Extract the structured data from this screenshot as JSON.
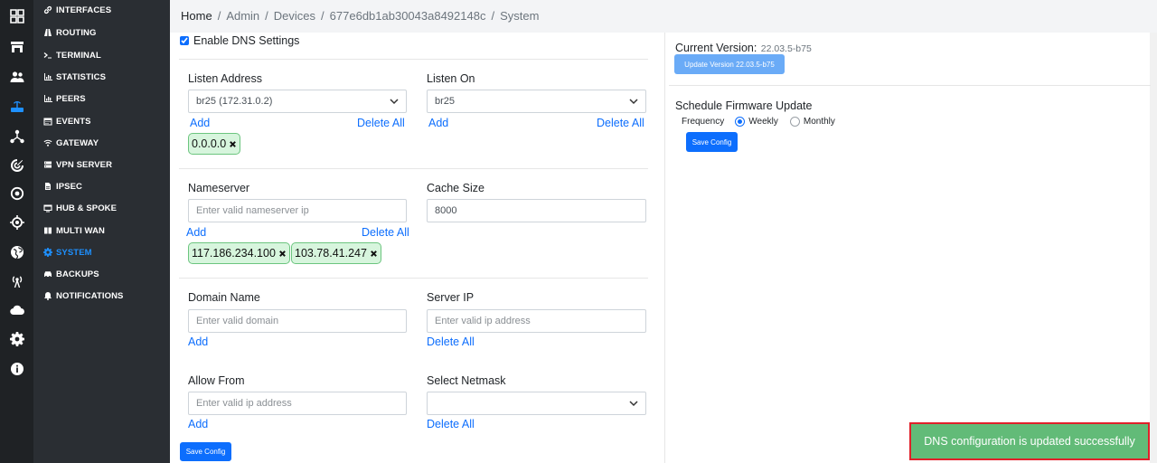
{
  "rail": [
    {
      "icon": "grid-icon"
    },
    {
      "icon": "store-icon"
    },
    {
      "icon": "users-icon"
    },
    {
      "icon": "router-icon",
      "active": true
    },
    {
      "icon": "network-icon"
    },
    {
      "icon": "radar-icon"
    },
    {
      "icon": "target-icon"
    },
    {
      "icon": "crosshair-icon"
    },
    {
      "icon": "globe-icon"
    },
    {
      "icon": "antenna-icon"
    },
    {
      "icon": "cloud-icon"
    },
    {
      "icon": "gear-icon"
    },
    {
      "icon": "info-icon"
    }
  ],
  "sidebar": {
    "items": [
      {
        "label": "INTERFACES",
        "icon": "link-icon"
      },
      {
        "label": "ROUTING",
        "icon": "road-icon"
      },
      {
        "label": "TERMINAL",
        "icon": "terminal-icon"
      },
      {
        "label": "STATISTICS",
        "icon": "bar-chart-icon"
      },
      {
        "label": "PEERS",
        "icon": "bar-chart-icon"
      },
      {
        "label": "EVENTS",
        "icon": "calendar-icon"
      },
      {
        "label": "GATEWAY",
        "icon": "wifi-icon"
      },
      {
        "label": "VPN SERVER",
        "icon": "server-icon"
      },
      {
        "label": "IPSEC",
        "icon": "document-icon"
      },
      {
        "label": "HUB & SPOKE",
        "icon": "hub-icon"
      },
      {
        "label": "MULTI WAN",
        "icon": "columns-icon"
      },
      {
        "label": "SYSTEM",
        "icon": "gear-icon",
        "active": true
      },
      {
        "label": "BACKUPS",
        "icon": "car-icon"
      },
      {
        "label": "NOTIFICATIONS",
        "icon": "bell-icon"
      }
    ]
  },
  "breadcrumb": [
    "Home",
    "Admin",
    "Devices",
    "677e6db1ab30043a8492148c",
    "System"
  ],
  "dns": {
    "enable_label": "Enable DNS Settings",
    "enabled": true,
    "listen_address": {
      "label": "Listen Address",
      "value": "br25 (172.31.0.2)",
      "add": "Add",
      "delete_all": "Delete All",
      "chips": [
        "0.0.0.0"
      ]
    },
    "listen_on": {
      "label": "Listen On",
      "value": "br25",
      "add": "Add",
      "delete_all": "Delete All"
    },
    "nameserver": {
      "label": "Nameserver",
      "placeholder": "Enter valid nameserver ip",
      "add": "Add",
      "delete_all": "Delete All",
      "chips": [
        "117.186.234.100",
        "103.78.41.247"
      ]
    },
    "cache_size": {
      "label": "Cache Size",
      "value": "8000"
    },
    "domain_name": {
      "label": "Domain Name",
      "placeholder": "Enter valid domain",
      "add": "Add"
    },
    "server_ip": {
      "label": "Server IP",
      "placeholder": "Enter valid ip address",
      "delete_all": "Delete All"
    },
    "allow_from": {
      "label": "Allow From",
      "placeholder": "Enter valid ip address",
      "add": "Add"
    },
    "select_netmask": {
      "label": "Select Netmask",
      "value": "",
      "delete_all": "Delete All"
    },
    "save_label": "Save Config"
  },
  "firmware": {
    "current_label": "Current Version:",
    "current_value": "22.03.5-b75",
    "update_label": "Update Version 22.03.5-b75",
    "schedule_title": "Schedule Firmware Update",
    "frequency_label": "Frequency",
    "weekly_label": "Weekly",
    "monthly_label": "Monthly",
    "selected": "weekly",
    "save_label": "Save Config"
  },
  "toast": {
    "message": "DNS configuration is updated successfully"
  },
  "colors": {
    "accent": "#0d6efd",
    "active_nav": "#1e90ff",
    "toast_bg": "#62bb78",
    "chip_bg": "#d7f5dd"
  }
}
